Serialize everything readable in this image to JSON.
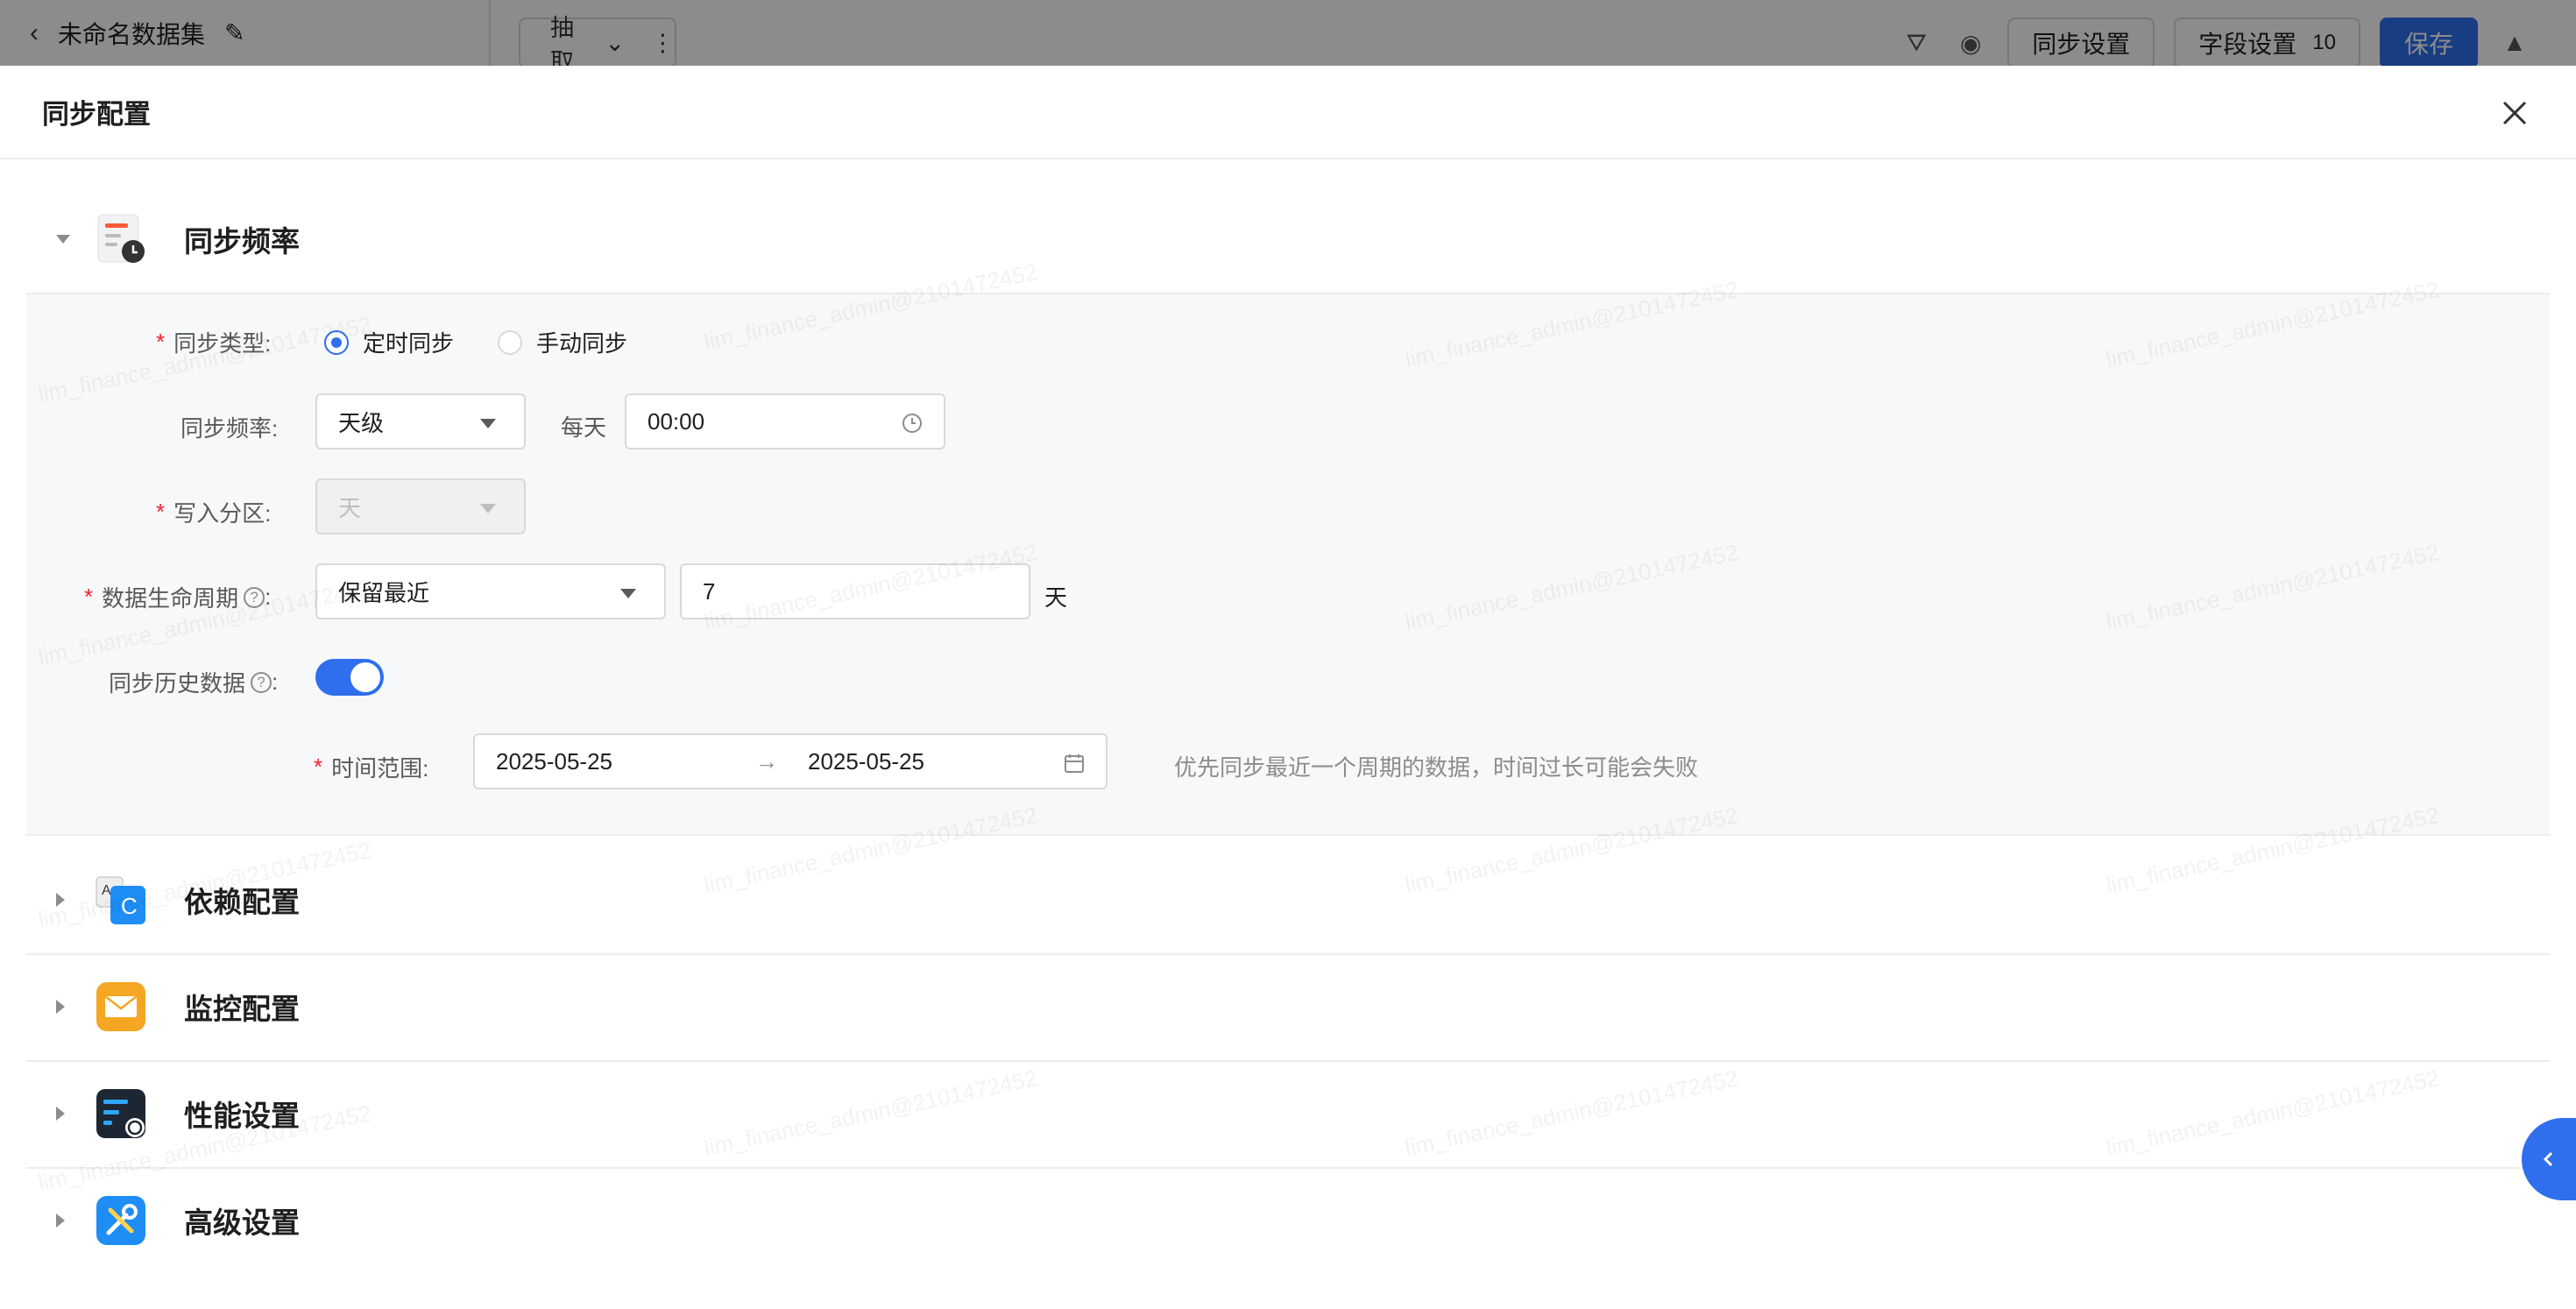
{
  "background_app": {
    "dataset_name": "未命名数据集",
    "extract_mode": "抽取",
    "sync_settings_label": "同步设置",
    "field_settings_label": "字段设置",
    "field_count": "10",
    "save_label": "保存"
  },
  "drawer": {
    "title": "同步配置"
  },
  "sections": {
    "sync_frequency": {
      "title": "同步频率",
      "sync_type": {
        "label": "同步类型:",
        "options": [
          "定时同步",
          "手动同步"
        ],
        "selected": "定时同步"
      },
      "frequency": {
        "label": "同步频率:",
        "value": "天级",
        "every_label": "每天",
        "time_value": "00:00"
      },
      "partition": {
        "label": "写入分区:",
        "value": "天"
      },
      "lifecycle": {
        "label": "数据生命周期",
        "colon": ":",
        "mode": "保留最近",
        "count": "7",
        "unit": "天"
      },
      "history": {
        "label": "同步历史数据",
        "colon": ":",
        "enabled": true
      },
      "time_range": {
        "label": "时间范围:",
        "start": "2025-05-25",
        "end": "2025-05-25",
        "hint": "优先同步最近一个周期的数据，时间过长可能会失败"
      }
    },
    "dependency": {
      "title": "依赖配置"
    },
    "monitoring": {
      "title": "监控配置"
    },
    "performance": {
      "title": "性能设置"
    },
    "advanced": {
      "title": "高级设置"
    }
  },
  "watermark": "lim_finance_admin@2101472452",
  "colors": {
    "primary": "#2f6fed",
    "required": "#f5222d",
    "panel_bg": "#f7f8fa"
  }
}
